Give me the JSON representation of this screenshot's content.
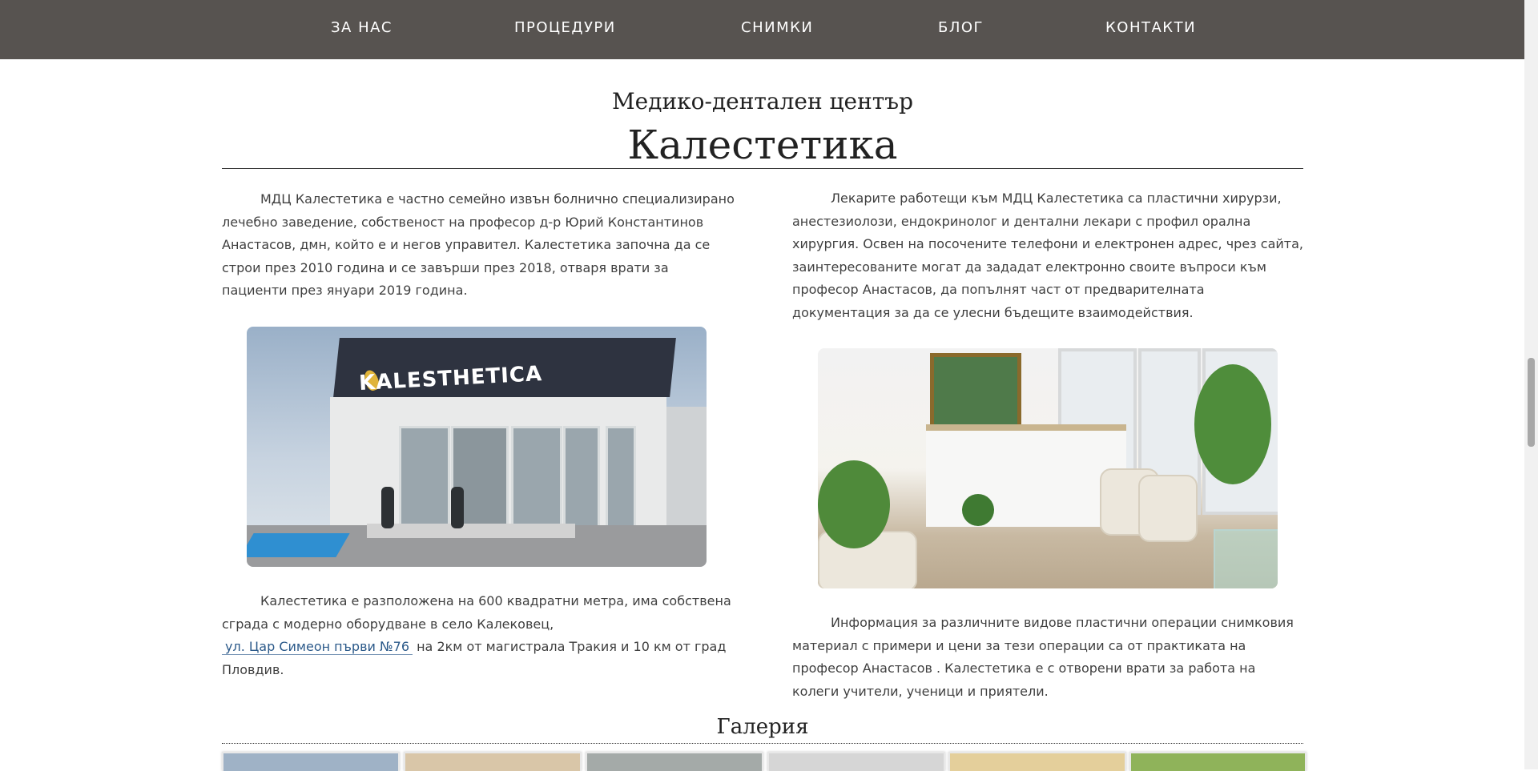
{
  "nav": {
    "items": [
      {
        "label": "ЗА НАС"
      },
      {
        "label": "ПРОЦЕДУРИ"
      },
      {
        "label": "СНИМКИ"
      },
      {
        "label": "БЛОГ"
      },
      {
        "label": "КОНТАКТИ"
      }
    ]
  },
  "header": {
    "subtitle": "Медико-дентален център",
    "title": "Калестетика"
  },
  "left": {
    "intro": "МДЦ Калестетика е частно семейно извън болнично специализирано лечебно заведение, собственост на професор д-р Юрий Константинов Анастасов, дмн, който е и негов управител. Калестетика започна да се строи през 2010 година и се завърши през 2018, отваря врати за пациенти през януари 2019 година.",
    "photo_logo_text": "KALESTHETICA",
    "location_before": "Калестетика е разположена на 600 квадратни метра, има собствена сграда с модерно оборудване в село Калековец,",
    "address_link": "ул. Цар Симеон първи №76",
    "location_after": "на 2км от магистрала Тракия и 10 км от град Пловдив."
  },
  "right": {
    "doctors": "Лекарите работещи към МДЦ Калестетика са пластични хирурзи, анестезиолози, ендокринолог и дентални лекари с профил орална хирургия. Освен на посочените телефони и електронен адрес, чрез сайта, заинтересованите могат да зададат електронно своите въпроси към професор Анастасов, да попълнят част от предварителната документация за да се улесни бъдещите взаимодействия.",
    "info": "Информация за различните видове пластични операции снимковия материал с примери и цени за тези операции са от практиката на професор Анастасов . Калестетика е с отворени врати за работа на колеги учители, ученици и приятели."
  },
  "gallery": {
    "title": "Галерия",
    "thumb_colors": [
      "#9fb2c6",
      "#d9c6a8",
      "#a4aaa8",
      "#d6d6d6",
      "#e4cf9b",
      "#8fb35a"
    ]
  }
}
